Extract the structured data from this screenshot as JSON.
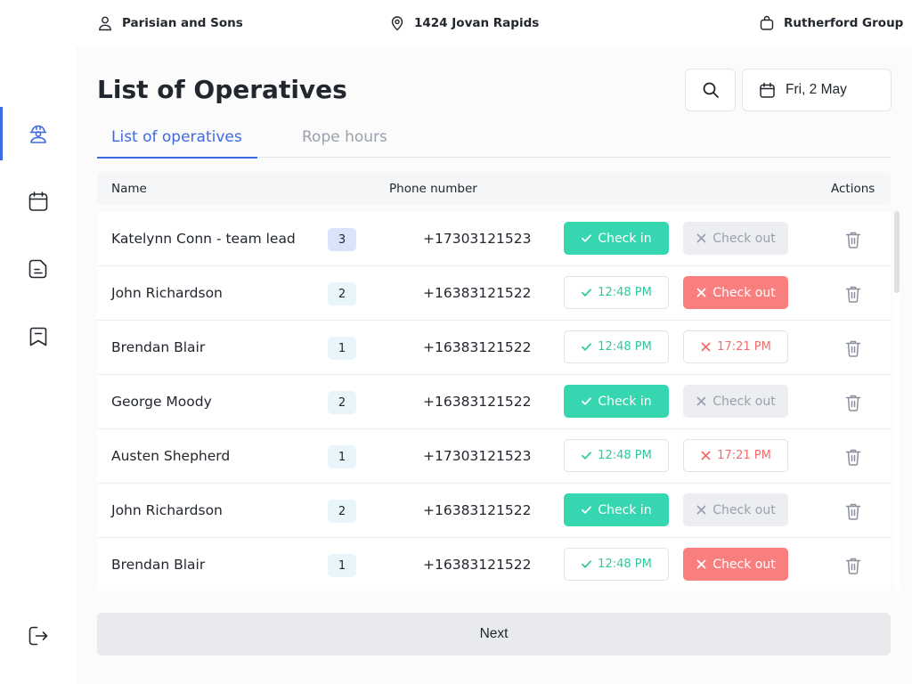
{
  "header": {
    "client": "Parisian and Sons",
    "location": "1424 Jovan Rapids",
    "company": "Rutherford Group"
  },
  "sidebar": {
    "items": [
      {
        "icon": "operative-icon",
        "active": true
      },
      {
        "icon": "calendar-icon",
        "active": false
      },
      {
        "icon": "document-icon",
        "active": false
      },
      {
        "icon": "bookmark-icon",
        "active": false
      }
    ],
    "logout_icon": "logout-icon"
  },
  "page": {
    "title": "List of Operatives",
    "date": "Fri, 2 May"
  },
  "tabs": [
    {
      "label": "List of operatives",
      "active": true
    },
    {
      "label": "Rope hours",
      "active": false
    }
  ],
  "table": {
    "columns": {
      "name": "Name",
      "phone": "Phone number",
      "actions": "Actions"
    },
    "rows": [
      {
        "name": "Katelynn Conn - team lead",
        "count": "3",
        "phone": "+17303121523",
        "check_in": "Check in",
        "check_in_state": "action",
        "check_out": "Check out",
        "check_out_state": "disabled"
      },
      {
        "name": "John Richardson",
        "count": "2",
        "phone": "+16383121522",
        "check_in": "12:48 PM",
        "check_in_state": "done",
        "check_out": "Check out",
        "check_out_state": "action"
      },
      {
        "name": "Brendan Blair",
        "count": "1",
        "phone": "+16383121522",
        "check_in": "12:48 PM",
        "check_in_state": "done",
        "check_out": "17:21 PM",
        "check_out_state": "done"
      },
      {
        "name": "George Moody",
        "count": "2",
        "phone": "+16383121522",
        "check_in": "Check in",
        "check_in_state": "action",
        "check_out": "Check out",
        "check_out_state": "disabled"
      },
      {
        "name": "Austen Shepherd",
        "count": "1",
        "phone": "+17303121523",
        "check_in": "12:48 PM",
        "check_in_state": "done",
        "check_out": "17:21 PM",
        "check_out_state": "done"
      },
      {
        "name": "John Richardson",
        "count": "2",
        "phone": "+16383121522",
        "check_in": "Check in",
        "check_in_state": "action",
        "check_out": "Check out",
        "check_out_state": "disabled"
      },
      {
        "name": "Brendan Blair",
        "count": "1",
        "phone": "+16383121522",
        "check_in": "12:48 PM",
        "check_in_state": "done",
        "check_out": "Check out",
        "check_out_state": "action"
      }
    ]
  },
  "footer": {
    "next_label": "Next"
  },
  "colors": {
    "accent": "#3e6ae1",
    "check_in": "#35d6b0",
    "check_out": "#f97f7f",
    "disabled": "#eceef1"
  }
}
